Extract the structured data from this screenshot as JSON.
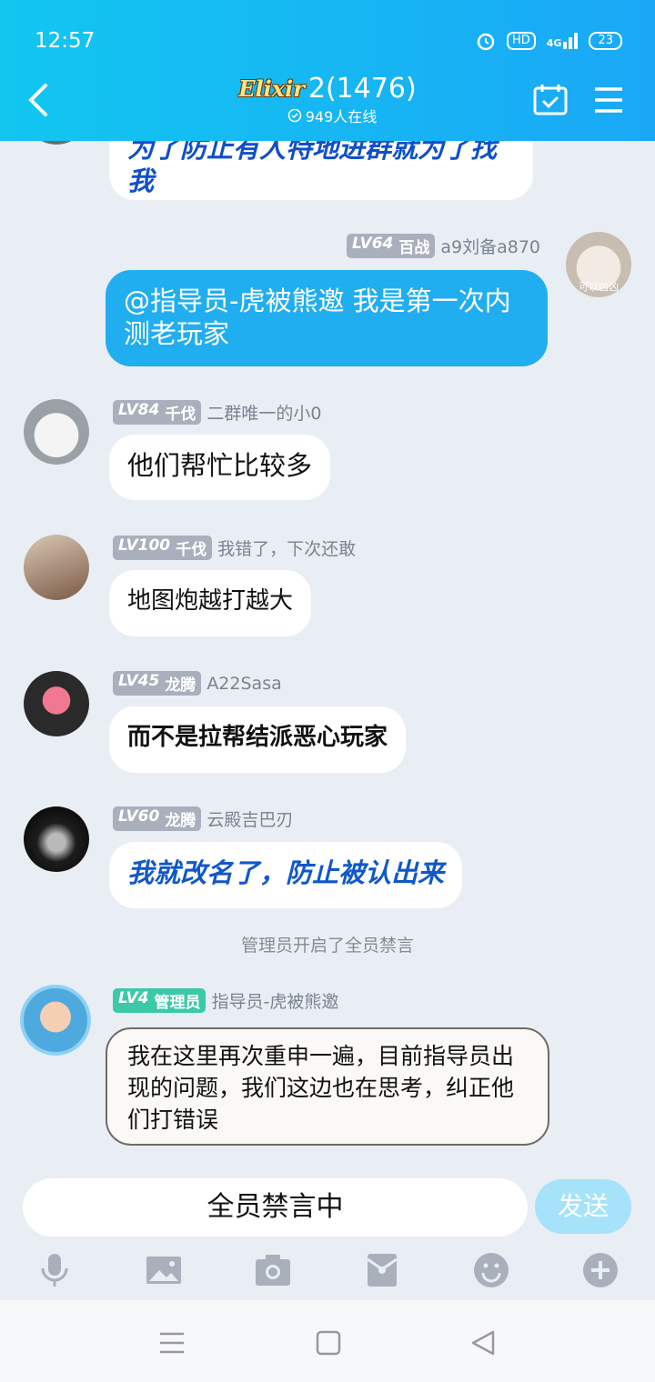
{
  "status_bar": {
    "time": "12:57",
    "hd": "HD",
    "network": "4G",
    "battery": "23"
  },
  "header": {
    "logo_text": "Elixir",
    "title": "2(1476)",
    "online": "949人在线"
  },
  "messages": [
    {
      "side": "left",
      "text": "为了防止有人特地进群就为了找我"
    },
    {
      "side": "right",
      "level": "LV64",
      "rank": "百战",
      "name": "a9刘备a870",
      "avatar_caption": "可以凶凶",
      "text": "@指导员-虎被熊邀 我是第一次内测老玩家"
    },
    {
      "side": "left",
      "level": "LV84",
      "rank": "千伐",
      "name": "二群唯一的小0",
      "text": "他们帮忙比较多"
    },
    {
      "side": "left",
      "level": "LV100",
      "rank": "千伐",
      "name": "我错了，下次还敢",
      "text": "地图炮越打越大"
    },
    {
      "side": "left",
      "level": "LV45",
      "rank": "龙腾",
      "name": "A22Sasa",
      "text": "而不是拉帮结派恶心玩家"
    },
    {
      "side": "left",
      "level": "LV60",
      "rank": "龙腾",
      "name": "云殿吉巴刃",
      "text": "我就改名了，防止被认出来"
    },
    {
      "side": "left",
      "level": "LV4",
      "rank": "管理员",
      "name": "指导员-虎被熊邀",
      "text": "我在这里再次重申一遍，目前指导员出现的问题，我们这边也在思考，纠正他们打错误"
    }
  ],
  "system_notice": "管理员开启了全员禁言",
  "input": {
    "placeholder": "全员禁言中",
    "send_label": "发送"
  },
  "colors": {
    "header": "#1aa8f6",
    "bubble_self": "#21aef0",
    "admin_tag": "#3cc9a8"
  }
}
